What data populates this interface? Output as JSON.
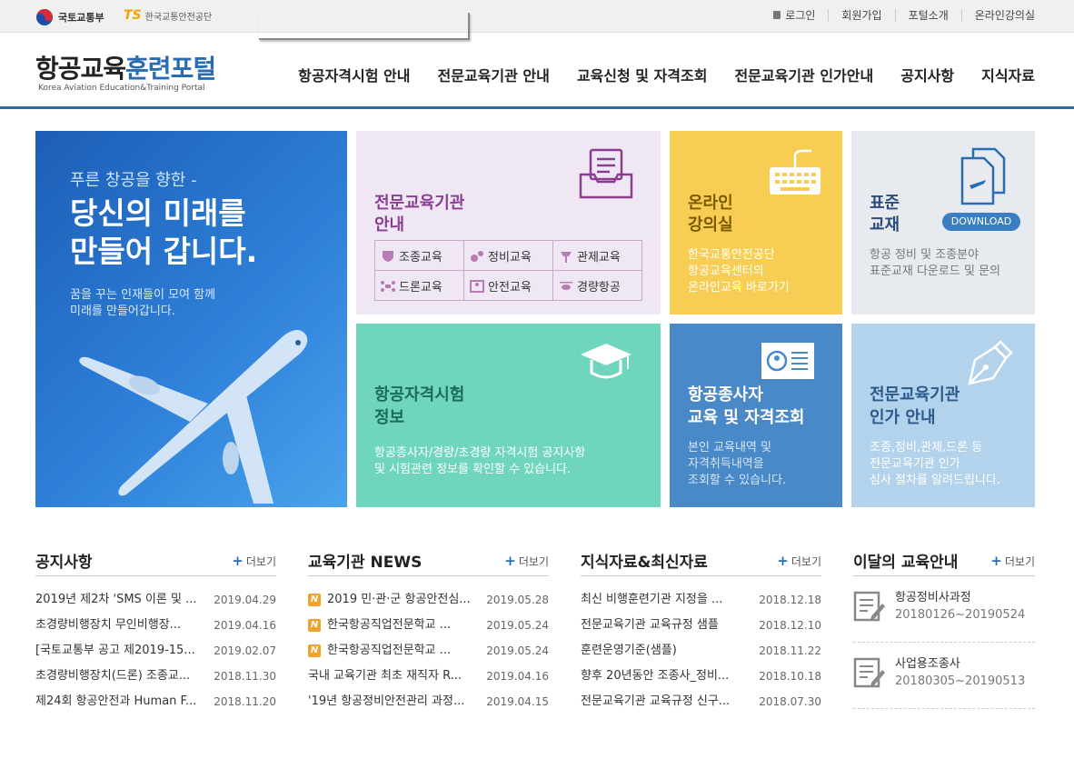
{
  "topbar": {
    "gov_label": "국토교통부",
    "ts_mark": "TS",
    "ts_label": "한국교통안전공단",
    "util_links": [
      "로그인",
      "회원가입",
      "포털소개",
      "온라인강의실"
    ]
  },
  "header": {
    "title_a": "항공교육",
    "title_b": "훈련포털",
    "subtitle": "Korea Aviation Education&Training Portal",
    "nav": [
      "항공자격시험 안내",
      "전문교육기관 안내",
      "교육신청 및 자격조회",
      "전문교육기관 인가안내",
      "공지사항",
      "지식자료"
    ]
  },
  "hero": {
    "sub": "푸른 창공을 향한 -",
    "headline": "당신의 미래를\n만들어 갑니다.",
    "text": "꿈을 꾸는 인재들이 모여 함께\n미래를 만들어갑니다."
  },
  "tiles": {
    "institutions": {
      "title": "전문교육기관\n안내",
      "items": [
        "조종교육",
        "정비교육",
        "관제교육",
        "드론교육",
        "안전교육",
        "경량항공"
      ]
    },
    "online": {
      "title": "온라인\n강의실",
      "text": "한국교통안전공단\n항공교육센터의\n온라인교육 바로가기"
    },
    "textbook": {
      "title": "표준\n교재",
      "download": "DOWNLOAD",
      "text": "항공 정비 및 조종분야\n표준교재 다운로드 및 문의"
    },
    "exam": {
      "title": "항공자격시험\n정보",
      "text": "항공종사자/경량/초경량 자격시험 공지사항\n및 시험관련 정보를 확인할 수 있습니다."
    },
    "staff": {
      "title": "항공종사자\n교육 및 자격조회",
      "text": "본인 교육내역 및\n자격취득내역을\n조회할 수 있습니다."
    },
    "accreditation": {
      "title": "전문교육기관\n인가 안내",
      "text": "조종,정비,관제,드론 등\n전문교육기관 인가\n심사 절차를 알려드립니다."
    }
  },
  "more_label": "더보기",
  "boards": {
    "notice": {
      "title": "공지사항",
      "rows": [
        {
          "text": "2019년 제2차 'SMS 이론 및 ...",
          "date": "2019.04.29"
        },
        {
          "text": "초경량비행장치 무인비행장...",
          "date": "2019.04.16"
        },
        {
          "text": "[국토교통부 공고 제2019-15...",
          "date": "2019.02.07"
        },
        {
          "text": "초경량비행장치(드론) 조종교...",
          "date": "2018.11.30"
        },
        {
          "text": "제24회 항공안전과 Human F...",
          "date": "2018.11.20"
        }
      ]
    },
    "news": {
      "title": "교육기관 NEWS",
      "new_badge": "N",
      "rows": [
        {
          "text": "2019 민·관·군 항공안전심...",
          "date": "2019.05.28",
          "new": true
        },
        {
          "text": "한국항공직업전문학교 ...",
          "date": "2019.05.24",
          "new": true
        },
        {
          "text": "한국항공직업전문학교 ...",
          "date": "2019.05.24",
          "new": true
        },
        {
          "text": "국내 교육기관 최초 재직자 R...",
          "date": "2019.04.16",
          "new": false
        },
        {
          "text": "'19년 항공정비안전관리 과정...",
          "date": "2019.04.15",
          "new": false
        }
      ]
    },
    "knowledge": {
      "title": "지식자료&최신자료",
      "rows": [
        {
          "text": "최신 비행훈련기관 지정을 ...",
          "date": "2018.12.18"
        },
        {
          "text": "전문교육기관 교육규정 샘플",
          "date": "2018.12.10"
        },
        {
          "text": "훈련운영기준(샘플)",
          "date": "2018.11.22"
        },
        {
          "text": "향후 20년동안 조종사_정비...",
          "date": "2018.10.18"
        },
        {
          "text": "전문교육기관 교육규정 신구...",
          "date": "2018.07.30"
        }
      ]
    },
    "monthly": {
      "title": "이달의 교육안내",
      "items": [
        {
          "name": "항공정비사과정",
          "period": "20180126~20190524"
        },
        {
          "name": "사업용조종사",
          "period": "20180305~20190513"
        }
      ]
    }
  },
  "colors": {
    "brand_blue": "#2b6cb0",
    "purple": "#8a3e8f",
    "yellow": "#f8cd54",
    "mint": "#6fd6bd",
    "steel_blue": "#4a89c8",
    "light_blue": "#b3d2ec"
  }
}
